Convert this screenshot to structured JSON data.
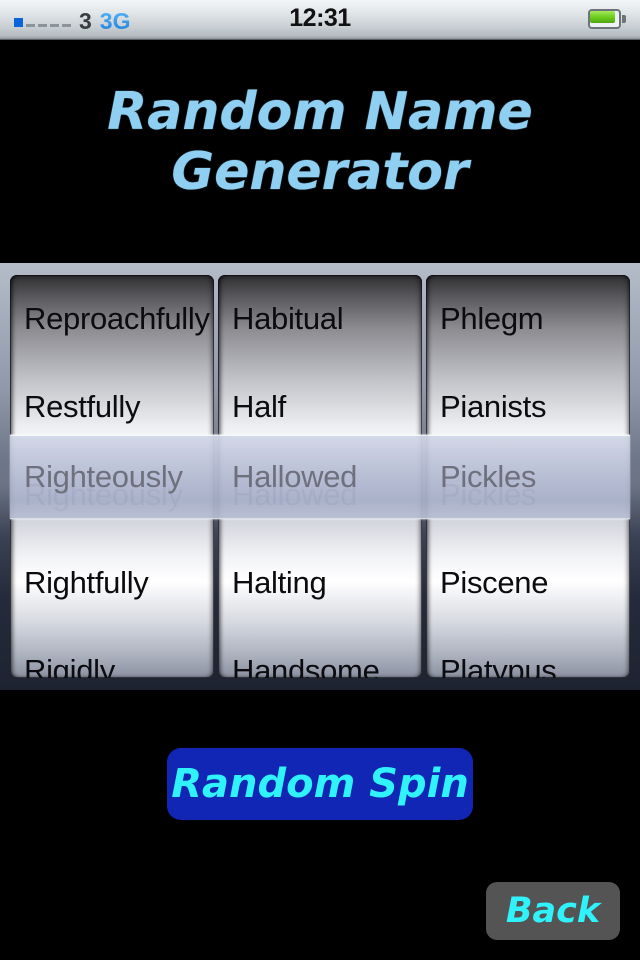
{
  "status_bar": {
    "signal_bars_filled": 1,
    "signal_bars_total": 5,
    "carrier": "3",
    "network": "3G",
    "clock": "12:31",
    "battery_level": "full",
    "battery_color": "#6fcf1f"
  },
  "header": {
    "title": "Random Name Generator",
    "title_color": "#8fd0f2"
  },
  "picker": {
    "columns": [
      {
        "name": "adverb-column",
        "above": [
          "Reproachfully",
          "Restfully"
        ],
        "selected": "Righteously",
        "below": [
          "Rightfully",
          "Rigidly"
        ]
      },
      {
        "name": "adjective-column",
        "above": [
          "Habitual",
          "Half"
        ],
        "selected": "Hallowed",
        "below": [
          "Halting",
          "Handsome"
        ]
      },
      {
        "name": "noun-column",
        "above": [
          "Phlegm",
          "Pianists"
        ],
        "selected": "Pickles",
        "below": [
          "Piscene",
          "Platypus"
        ]
      }
    ],
    "selected_row_text_color": "#6e717d",
    "row_text_color": "#0b0b10"
  },
  "actions": {
    "spin_label": "Random Spin",
    "spin_bg": "#1226b5",
    "spin_text_color": "#2ff2fb",
    "back_label": "Back",
    "back_bg": "#545454",
    "back_text_color": "#2ff2fb"
  }
}
